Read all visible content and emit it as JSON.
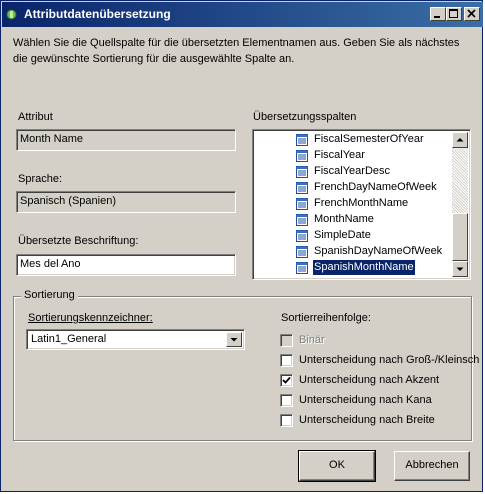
{
  "window": {
    "title": "Attributdatenübersetzung"
  },
  "description": "Wählen Sie die Quellspalte für die übersetzten Elementnamen aus. Geben Sie als nächstes die gewünschte Sortierung für die ausgewählte Spalte an.",
  "attribute": {
    "label": "Attribut",
    "value": "Month Name"
  },
  "language": {
    "label": "Sprache:",
    "value": "Spanisch (Spanien)"
  },
  "caption": {
    "label": "Übersetzte Beschriftung:",
    "value": "Mes del Ano"
  },
  "translation_columns": {
    "label": "Übersetzungsspalten",
    "items": [
      {
        "label": "FiscalSemesterOfYear",
        "icon": "column-icon",
        "selected": false
      },
      {
        "label": "FiscalYear",
        "icon": "column-icon",
        "selected": false
      },
      {
        "label": "FiscalYearDesc",
        "icon": "column-icon",
        "selected": false
      },
      {
        "label": "FrenchDayNameOfWeek",
        "icon": "column-icon",
        "selected": false
      },
      {
        "label": "FrenchMonthName",
        "icon": "column-icon",
        "selected": false
      },
      {
        "label": "MonthName",
        "icon": "column-icon",
        "selected": false
      },
      {
        "label": "SimpleDate",
        "icon": "column-icon",
        "selected": false
      },
      {
        "label": "SpanishDayNameOfWeek",
        "icon": "column-icon",
        "selected": false
      },
      {
        "label": "SpanishMonthName",
        "icon": "column-icon",
        "selected": true
      }
    ]
  },
  "sorting": {
    "group_label": "Sortierung",
    "identifier_label": "Sortierungskennzeichner:",
    "identifier_value": "Latin1_General",
    "order_label": "Sortierreihenfolge:",
    "options": [
      {
        "label": "Binär",
        "checked": false,
        "enabled": false
      },
      {
        "label": "Unterscheidung nach Groß-/Kleinsch",
        "checked": false,
        "enabled": true
      },
      {
        "label": "Unterscheidung nach Akzent",
        "checked": true,
        "enabled": true
      },
      {
        "label": "Unterscheidung nach Kana",
        "checked": false,
        "enabled": true
      },
      {
        "label": "Unterscheidung nach Breite",
        "checked": false,
        "enabled": true
      }
    ]
  },
  "buttons": {
    "ok": "OK",
    "cancel": "Abbrechen"
  },
  "colors": {
    "titlebar": "#0a246a",
    "face": "#d4d0c8",
    "selection": "#0a246a"
  }
}
